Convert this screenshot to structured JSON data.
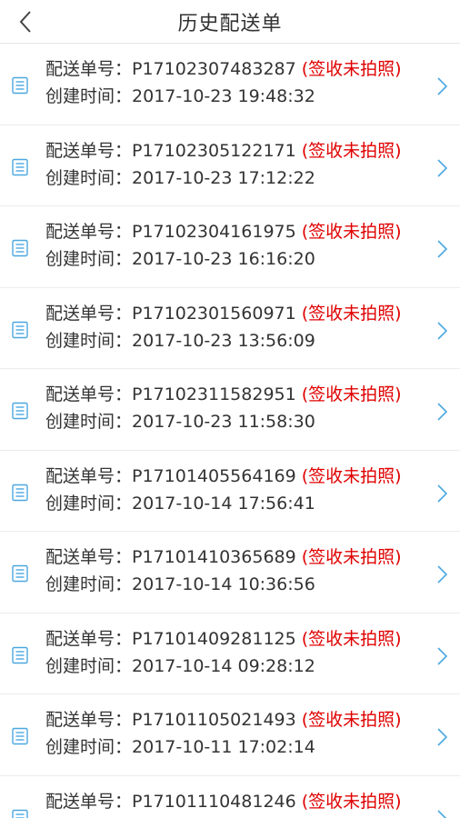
{
  "header": {
    "title": "历史配送单",
    "back_icon": "chevron-left-icon"
  },
  "labels": {
    "order_no": "配送单号：",
    "created": "创建时间："
  },
  "colors": {
    "status": "#e00000",
    "icon": "#4aa8e0"
  },
  "orders": [
    {
      "order_no": "P17102307483287",
      "status": "(签收未拍照)",
      "created": "2017-10-23 19:48:32"
    },
    {
      "order_no": "P17102305122171",
      "status": "(签收未拍照)",
      "created": "2017-10-23 17:12:22"
    },
    {
      "order_no": "P17102304161975",
      "status": "(签收未拍照)",
      "created": "2017-10-23 16:16:20"
    },
    {
      "order_no": "P17102301560971",
      "status": "(签收未拍照)",
      "created": "2017-10-23 13:56:09"
    },
    {
      "order_no": "P17102311582951",
      "status": "(签收未拍照)",
      "created": "2017-10-23 11:58:30"
    },
    {
      "order_no": "P17101405564169",
      "status": "(签收未拍照)",
      "created": "2017-10-14 17:56:41"
    },
    {
      "order_no": "P17101410365689",
      "status": "(签收未拍照)",
      "created": "2017-10-14 10:36:56"
    },
    {
      "order_no": "P17101409281125",
      "status": "(签收未拍照)",
      "created": "2017-10-14 09:28:12"
    },
    {
      "order_no": "P17101105021493",
      "status": "(签收未拍照)",
      "created": "2017-10-11 17:02:14"
    },
    {
      "order_no": "P17101110481246",
      "status": "(签收未拍照)",
      "created": ""
    }
  ]
}
